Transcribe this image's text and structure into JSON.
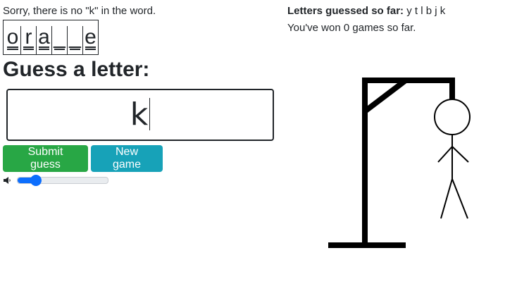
{
  "status": {
    "message": "Sorry, there is no \"k\" in the word."
  },
  "word": {
    "letters": [
      "o",
      "r",
      "a",
      "_",
      "_",
      "e"
    ]
  },
  "guess": {
    "heading": "Guess a letter:",
    "input_value": "k"
  },
  "buttons": {
    "submit_label": "Submit guess",
    "new_game_label": "New game"
  },
  "audio": {
    "volume": 0.2
  },
  "sidebar": {
    "guessed_label": "Letters guessed so far:",
    "guessed_letters": "y t l b j k",
    "games_won_text": "You've won 0 games so far."
  },
  "hangman": {
    "wrong_guesses": 6
  },
  "colors": {
    "success": "#28a745",
    "info": "#17a2b8",
    "accent": "#0d6efd"
  }
}
